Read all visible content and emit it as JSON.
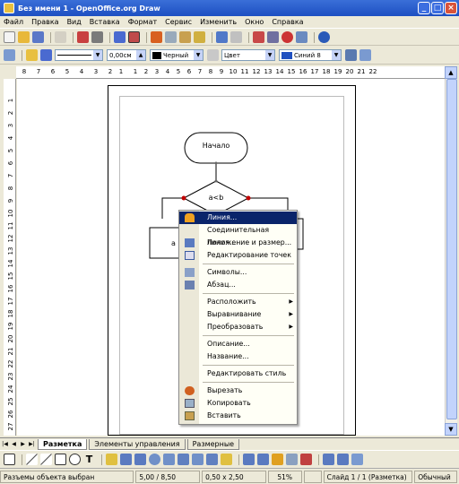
{
  "window": {
    "title": "Без имени 1 - OpenOffice.org Draw"
  },
  "menu": [
    "Файл",
    "Правка",
    "Вид",
    "Вставка",
    "Формат",
    "Сервис",
    "Изменить",
    "Окно",
    "Справка"
  ],
  "line_toolbar": {
    "line_width": "0,00см",
    "line_color": "Черный",
    "area_style": "Цвет",
    "area_color": "Синий 8"
  },
  "ruler_h": [
    "8",
    "7",
    "6",
    "5",
    "4",
    "3",
    "2",
    "1",
    "1",
    "2",
    "3",
    "4",
    "5",
    "6",
    "7",
    "8",
    "9",
    "10",
    "11",
    "12",
    "13",
    "14",
    "15",
    "16",
    "17",
    "18",
    "19",
    "20",
    "21",
    "22"
  ],
  "ruler_v": [
    "1",
    "2",
    "3",
    "4",
    "5",
    "6",
    "7",
    "8",
    "9",
    "10",
    "11",
    "12",
    "13",
    "14",
    "15",
    "16",
    "17",
    "18",
    "19",
    "20",
    "21",
    "22",
    "23",
    "24",
    "25",
    "26",
    "27"
  ],
  "flowchart": {
    "start_label": "Начало",
    "decision_label": "a<b",
    "left_box_label": "a"
  },
  "context_menu": {
    "items": [
      {
        "label": "Линия...",
        "icon": "line-icon"
      },
      {
        "label": "Соединительная линия...",
        "icon": ""
      },
      {
        "label": "Положение и размер...",
        "icon": "position-size-icon"
      },
      {
        "label": "Редактирование точек",
        "icon": "edit-points-icon"
      },
      {
        "label": "Символы...",
        "icon": "character-icon"
      },
      {
        "label": "Абзац...",
        "icon": "paragraph-icon"
      },
      {
        "label": "Расположить",
        "icon": "",
        "submenu": "▶"
      },
      {
        "label": "Выравнивание",
        "icon": "",
        "submenu": "▶"
      },
      {
        "label": "Преобразовать",
        "icon": "",
        "submenu": "▶"
      },
      {
        "label": "Описание...",
        "icon": ""
      },
      {
        "label": "Название...",
        "icon": ""
      },
      {
        "label": "Редактировать стиль",
        "icon": ""
      },
      {
        "label": "Вырезать",
        "icon": "scissors-icon"
      },
      {
        "label": "Копировать",
        "icon": "copy-icon"
      },
      {
        "label": "Вставить",
        "icon": "paste-icon"
      }
    ]
  },
  "tabs": [
    "Разметка",
    "Элементы управления",
    "Размерные"
  ],
  "status": {
    "selection": "Разъемы объекта выбран",
    "position": "5,00 / 8,50",
    "size": "0,50 x 2,50",
    "zoom": "51%",
    "slide": "Слайд 1 / 1 (Разметка)",
    "style": "Обычный"
  },
  "colors": {
    "title_bar": "#2458d0",
    "menu_highlight": "#0a246a",
    "workspace": "#ece9d8"
  }
}
